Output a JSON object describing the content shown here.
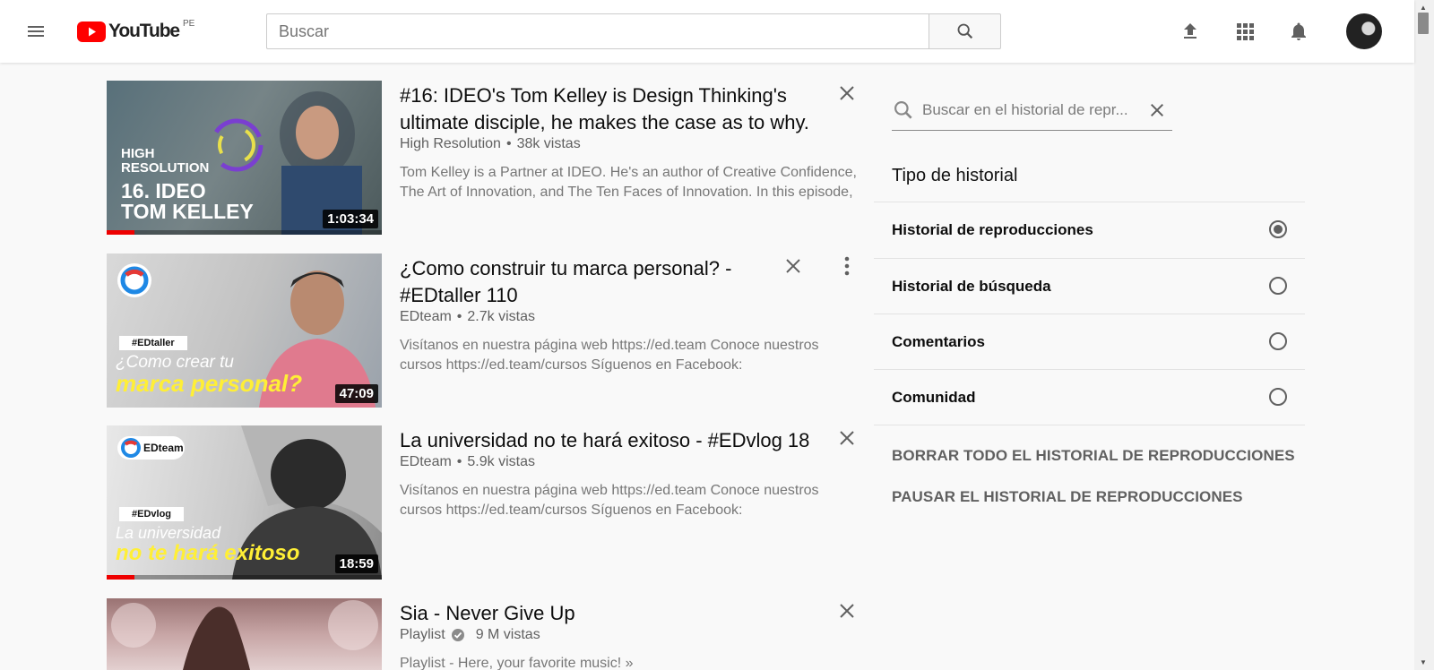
{
  "header": {
    "logo_text": "YouTube",
    "logo_country": "PE",
    "search_placeholder": "Buscar"
  },
  "videos": [
    {
      "title": "#16: IDEO's Tom Kelley is Design Thinking's ultimate disciple, he makes the case as to why.",
      "channel": "High Resolution",
      "views": "38k vistas",
      "description": "Tom Kelley is a Partner at IDEO. He's an author of Creative Confidence, The Art of Innovation, and The Ten Faces of Innovation. In this episode,",
      "duration": "1:03:34",
      "watched_fraction": 0.1,
      "thumb_lines": [
        "HIGH",
        "RESOLUTION",
        "16. IDEO",
        "TOM KELLEY"
      ]
    },
    {
      "title": "¿Como construir tu marca personal? - #EDtaller 110",
      "channel": "EDteam",
      "views": "2.7k vistas",
      "description": "Visítanos en nuestra página web https://ed.team Conoce nuestros cursos https://ed.team/cursos Síguenos en Facebook:",
      "duration": "47:09",
      "thumb_tag": "#EDtaller",
      "thumb_lines": [
        "¿Como crear tu",
        "marca personal?"
      ]
    },
    {
      "title": "La universidad no te hará exitoso - #EDvlog 18",
      "channel": "EDteam",
      "views": "5.9k vistas",
      "description": "Visítanos en nuestra página web https://ed.team Conoce nuestros cursos https://ed.team/cursos Síguenos en Facebook:",
      "duration": "18:59",
      "watched_fraction": 0.1,
      "thumb_badge": "EDteam",
      "thumb_tag": "#EDvlog",
      "thumb_lines": [
        "La universidad",
        "no te hará exitoso"
      ]
    },
    {
      "title": "Sia - Never Give Up",
      "channel": "Playlist",
      "views": "9 M vistas",
      "description": "Playlist - Here, your favorite music! »"
    }
  ],
  "history_panel": {
    "search_placeholder": "Buscar en el historial de repr...",
    "type_title": "Tipo de historial",
    "options": [
      {
        "label": "Historial de reproducciones",
        "selected": true
      },
      {
        "label": "Historial de búsqueda",
        "selected": false
      },
      {
        "label": "Comentarios",
        "selected": false
      },
      {
        "label": "Comunidad",
        "selected": false
      }
    ],
    "clear_all": "BORRAR TODO EL HISTORIAL DE REPRODUCCIONES",
    "pause": "PAUSAR EL HISTORIAL DE REPRODUCCIONES"
  },
  "colors": {
    "brand_red": "#ff0000",
    "progress_red": "#ee0000",
    "text_secondary": "#606060"
  },
  "icons": [
    "hamburger-menu-icon",
    "search-icon",
    "upload-icon",
    "apps-grid-icon",
    "notifications-bell-icon",
    "close-icon",
    "more-vert-icon",
    "verified-icon"
  ]
}
